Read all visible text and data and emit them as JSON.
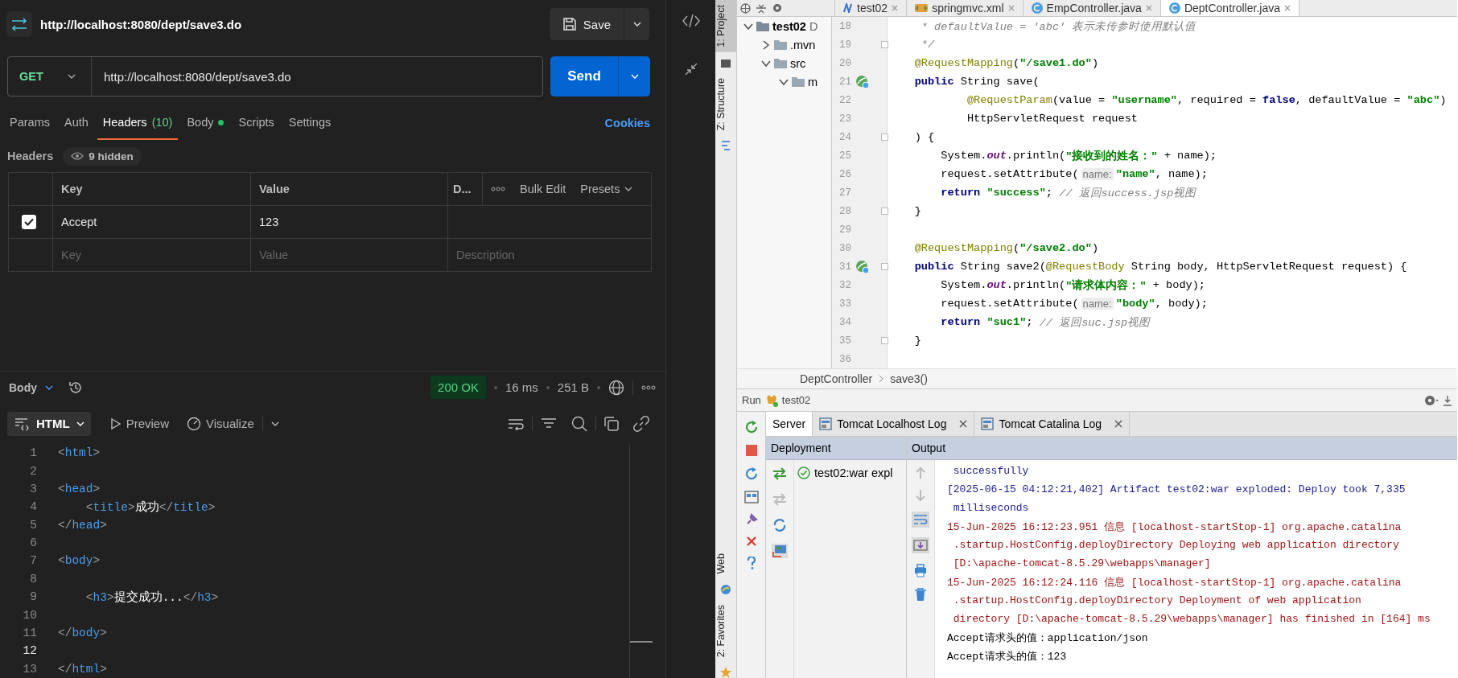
{
  "request": {
    "title": "http://localhost:8080/dept/save3.do",
    "save": "Save",
    "method": "GET",
    "url": "http://localhost:8080/dept/save3.do",
    "send": "Send"
  },
  "request_tabs": [
    {
      "label": "Params",
      "has_content": false,
      "selected": false
    },
    {
      "label": "Auth",
      "has_content": false,
      "selected": false
    },
    {
      "label": "Headers",
      "count": "(10)",
      "has_content": false,
      "selected": true
    },
    {
      "label": "Body",
      "has_content": true,
      "selected": false
    },
    {
      "label": "Scripts",
      "has_content": false,
      "selected": false
    },
    {
      "label": "Settings",
      "has_content": false,
      "selected": false
    }
  ],
  "cookies": "Cookies",
  "headers": {
    "title": "Headers",
    "hidden": "9 hidden",
    "columns": [
      "Key",
      "Value",
      "D..."
    ],
    "bulk_edit": "Bulk Edit",
    "presets": "Presets",
    "rows": [
      {
        "checked": true,
        "key": "Accept",
        "value": "123"
      }
    ],
    "new_row": {
      "key": {
        "placeholder": "Key"
      },
      "value": {
        "placeholder": "Value"
      },
      "description": {
        "placeholder": "Description"
      }
    }
  },
  "response": {
    "tab": "Body",
    "status": "200 OK",
    "time": "16 ms",
    "size": "251 B",
    "format": "HTML",
    "preview": "Preview",
    "visualize": "Visualize",
    "lines": [
      {
        "number": "1",
        "current": false,
        "tokens": [
          {
            "kind": "punct",
            "text": "<"
          },
          {
            "kind": "tag",
            "text": "html"
          },
          {
            "kind": "punct",
            "text": ">"
          }
        ]
      },
      {
        "number": "2",
        "current": false
      },
      {
        "number": "3",
        "current": false,
        "tokens": [
          {
            "kind": "punct",
            "text": "<"
          },
          {
            "kind": "tag",
            "text": "head"
          },
          {
            "kind": "punct",
            "text": ">"
          }
        ]
      },
      {
        "number": "4",
        "current": false,
        "tokens": [
          {
            "kind": "punct",
            "text": "    <"
          },
          {
            "kind": "tag",
            "text": "title"
          },
          {
            "kind": "punct",
            "text": ">"
          },
          {
            "kind": "text",
            "text": "成功"
          },
          {
            "kind": "punct",
            "text": "</"
          },
          {
            "kind": "tag",
            "text": "title"
          },
          {
            "kind": "punct",
            "text": ">"
          }
        ]
      },
      {
        "number": "5",
        "current": false,
        "tokens": [
          {
            "kind": "punct",
            "text": "</"
          },
          {
            "kind": "tag",
            "text": "head"
          },
          {
            "kind": "punct",
            "text": ">"
          }
        ]
      },
      {
        "number": "6",
        "current": false
      },
      {
        "number": "7",
        "current": false,
        "tokens": [
          {
            "kind": "punct",
            "text": "<"
          },
          {
            "kind": "tag",
            "text": "body"
          },
          {
            "kind": "punct",
            "text": ">"
          }
        ]
      },
      {
        "number": "8",
        "current": false
      },
      {
        "number": "9",
        "current": false,
        "tokens": [
          {
            "kind": "punct",
            "text": "    <"
          },
          {
            "kind": "tag",
            "text": "h3"
          },
          {
            "kind": "punct",
            "text": ">"
          },
          {
            "kind": "text",
            "text": "提交成功..."
          },
          {
            "kind": "punct",
            "text": "</"
          },
          {
            "kind": "tag",
            "text": "h3"
          },
          {
            "kind": "punct",
            "text": ">"
          }
        ]
      },
      {
        "number": "10",
        "current": false
      },
      {
        "number": "11",
        "current": false,
        "tokens": [
          {
            "kind": "punct",
            "text": "</"
          },
          {
            "kind": "tag",
            "text": "body"
          },
          {
            "kind": "punct",
            "text": ">"
          }
        ]
      },
      {
        "number": "12",
        "current": true
      },
      {
        "number": "13",
        "current": false,
        "tokens": [
          {
            "kind": "punct",
            "text": "</"
          },
          {
            "kind": "tag",
            "text": "html"
          },
          {
            "kind": "punct",
            "text": ">"
          }
        ]
      }
    ]
  },
  "ide": {
    "tool_windows": {
      "top": [
        {
          "label": "1: Project",
          "selected": true
        },
        {
          "label": "Z: Structure",
          "selected": false
        }
      ],
      "bottom": [
        {
          "label": "Web",
          "selected": false
        },
        {
          "label": "2: Favorites",
          "selected": false
        }
      ]
    },
    "editor_tabs": [
      {
        "label": "test02",
        "kind": "maven",
        "selected": false
      },
      {
        "label": "springmvc.xml",
        "kind": "xml",
        "selected": false
      },
      {
        "label": "EmpController.java",
        "kind": "class",
        "selected": false
      },
      {
        "label": "DeptController.java",
        "kind": "class",
        "selected": true
      }
    ],
    "project_tree": [
      {
        "label": "test02",
        "detail": "D",
        "expanded": true,
        "children": [
          {
            "label": ".mvn",
            "expanded": false
          },
          {
            "label": "src",
            "expanded": true,
            "children": [
              {
                "label": "m",
                "expanded": true
              }
            ]
          }
        ]
      }
    ],
    "code": [
      {
        "number": "18",
        "fold": false,
        "tokens": [
          {
            "kind": "comment",
            "text": "     * defaultValue = 'abc' 表示未传参时使用默认值"
          }
        ]
      },
      {
        "number": "19",
        "fold": true,
        "tokens": [
          {
            "kind": "comment",
            "text": "     */"
          }
        ]
      },
      {
        "number": "20",
        "fold": false,
        "tokens": [
          {
            "kind": "ann",
            "text": "    @RequestMapping"
          },
          {
            "kind": "plain",
            "text": "("
          },
          {
            "kind": "str",
            "text": "\"/save1.do\""
          },
          {
            "kind": "plain",
            "text": ")"
          }
        ]
      },
      {
        "number": "21",
        "fold": false,
        "kind": "runnable",
        "tokens": [
          {
            "kind": "kw",
            "text": "    public"
          },
          {
            "kind": "plain",
            "text": " String save("
          }
        ]
      },
      {
        "number": "22",
        "fold": false,
        "tokens": [
          {
            "kind": "ann",
            "text": "            @RequestParam"
          },
          {
            "kind": "plain",
            "text": "(value = "
          },
          {
            "kind": "str",
            "text": "\"username\""
          },
          {
            "kind": "plain",
            "text": ", required = "
          },
          {
            "kind": "kw",
            "text": "false"
          },
          {
            "kind": "plain",
            "text": ", defaultValue = "
          },
          {
            "kind": "str",
            "text": "\"abc\""
          },
          {
            "kind": "plain",
            "text": ")"
          }
        ]
      },
      {
        "number": "23",
        "fold": false,
        "tokens": [
          {
            "kind": "plain",
            "text": "            HttpServletRequest request"
          }
        ]
      },
      {
        "number": "24",
        "fold": true,
        "tokens": [
          {
            "kind": "plain",
            "text": "    ) {"
          }
        ]
      },
      {
        "number": "25",
        "fold": false,
        "tokens": [
          {
            "kind": "plain",
            "text": "        System."
          },
          {
            "kind": "field",
            "text": "out"
          },
          {
            "kind": "plain",
            "text": ".println("
          },
          {
            "kind": "str",
            "text": "\"接收到的姓名：\""
          },
          {
            "kind": "plain",
            "text": " + name);"
          }
        ]
      },
      {
        "number": "26",
        "fold": false,
        "tokens": [
          {
            "kind": "plain",
            "text": "        request.setAttribute("
          },
          {
            "kind": "hint",
            "text": "name:"
          },
          {
            "kind": "str",
            "text": "\"name\""
          },
          {
            "kind": "plain",
            "text": ", name);"
          }
        ]
      },
      {
        "number": "27",
        "fold": false,
        "tokens": [
          {
            "kind": "kw",
            "text": "        return "
          },
          {
            "kind": "str",
            "text": "\"success\""
          },
          {
            "kind": "plain",
            "text": "; "
          },
          {
            "kind": "comment",
            "text": "// 返回success.jsp视图"
          }
        ]
      },
      {
        "number": "28",
        "fold": true,
        "tokens": [
          {
            "kind": "plain",
            "text": "    }"
          }
        ]
      },
      {
        "number": "29",
        "fold": false
      },
      {
        "number": "30",
        "fold": false,
        "tokens": [
          {
            "kind": "ann",
            "text": "    @RequestMapping"
          },
          {
            "kind": "plain",
            "text": "("
          },
          {
            "kind": "str",
            "text": "\"/save2.do\""
          },
          {
            "kind": "plain",
            "text": ")"
          }
        ]
      },
      {
        "number": "31",
        "fold": true,
        "kind": "runnable",
        "tokens": [
          {
            "kind": "kw",
            "text": "    public"
          },
          {
            "kind": "plain",
            "text": " String save2("
          },
          {
            "kind": "ann",
            "text": "@RequestBody"
          },
          {
            "kind": "plain",
            "text": " String body, HttpServletRequest request) {"
          }
        ]
      },
      {
        "number": "32",
        "fold": false,
        "tokens": [
          {
            "kind": "plain",
            "text": "        System."
          },
          {
            "kind": "field",
            "text": "out"
          },
          {
            "kind": "plain",
            "text": ".println("
          },
          {
            "kind": "str",
            "text": "\"请求体内容：\""
          },
          {
            "kind": "plain",
            "text": " + body);"
          }
        ]
      },
      {
        "number": "33",
        "fold": false,
        "tokens": [
          {
            "kind": "plain",
            "text": "        request.setAttribute("
          },
          {
            "kind": "hint",
            "text": "name:"
          },
          {
            "kind": "str",
            "text": "\"body\""
          },
          {
            "kind": "plain",
            "text": ", body);"
          }
        ]
      },
      {
        "number": "34",
        "fold": false,
        "tokens": [
          {
            "kind": "kw",
            "text": "        return "
          },
          {
            "kind": "str",
            "text": "\"suc1\""
          },
          {
            "kind": "plain",
            "text": "; "
          },
          {
            "kind": "comment",
            "text": "// 返回suc.jsp视图"
          }
        ]
      },
      {
        "number": "35",
        "fold": true,
        "tokens": [
          {
            "kind": "plain",
            "text": "    }"
          }
        ]
      },
      {
        "number": "36",
        "fold": false
      }
    ],
    "breadcrumb": [
      "DeptController",
      "save3()"
    ],
    "run": {
      "label": "Run",
      "config": "test02"
    },
    "run_tabs": [
      {
        "label": "Server",
        "closable": false,
        "selected": true
      },
      {
        "label": "Tomcat Localhost Log",
        "closable": true,
        "selected": false
      },
      {
        "label": "Tomcat Catalina Log",
        "closable": true,
        "selected": false
      }
    ],
    "deployment": {
      "title": "Deployment",
      "items": [
        {
          "label": "test02:war expl",
          "deployed": true
        }
      ]
    },
    "output": {
      "title": "Output",
      "lines": [
        {
          "kind": "info",
          "text": " successfully"
        },
        {
          "kind": "info",
          "text": "[2025-06-15 04:12:21,402] Artifact test02:war exploded: Deploy took 7,335"
        },
        {
          "kind": "info",
          "text": " milliseconds"
        },
        {
          "kind": "error",
          "text": "15-Jun-2025 16:12:23.951 信息 [localhost-startStop-1] org.apache.catalina"
        },
        {
          "kind": "error",
          "text": " .startup.HostConfig.deployDirectory Deploying web application directory"
        },
        {
          "kind": "error",
          "text": " [D:\\apache-tomcat-8.5.29\\webapps\\manager]"
        },
        {
          "kind": "error",
          "text": "15-Jun-2025 16:12:24.116 信息 [localhost-startStop-1] org.apache.catalina"
        },
        {
          "kind": "error",
          "text": " .startup.HostConfig.deployDirectory Deployment of web application"
        },
        {
          "kind": "error",
          "text": " directory [D:\\apache-tomcat-8.5.29\\webapps\\manager] has finished in [164] ms"
        },
        {
          "kind": "plain",
          "text": "Accept请求头的值：application/json"
        },
        {
          "kind": "plain",
          "text": "Accept请求头的值：123"
        }
      ]
    }
  }
}
